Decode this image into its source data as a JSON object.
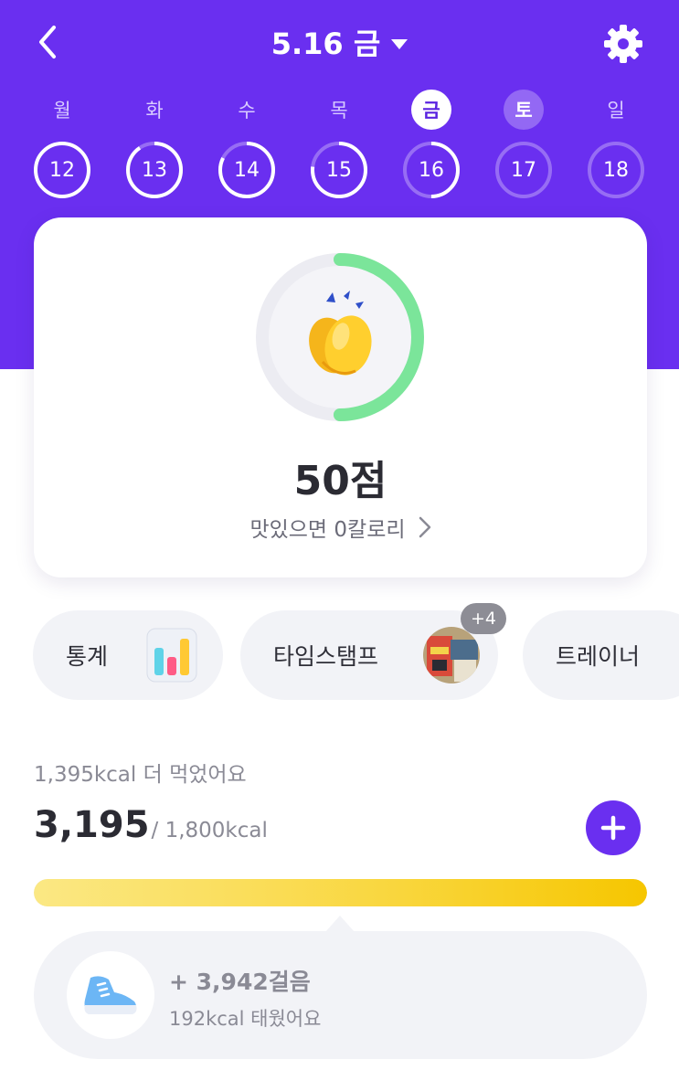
{
  "header": {
    "date_title": "5.16 금",
    "back_icon": "chevron-left-icon",
    "settings_icon": "gear-icon",
    "dropdown_icon": "caret-down-icon"
  },
  "week": {
    "weekdays": [
      "월",
      "화",
      "수",
      "목",
      "금",
      "토",
      "일"
    ],
    "days": [
      "12",
      "13",
      "14",
      "15",
      "16",
      "17",
      "18"
    ],
    "selected_index": 4
  },
  "score_card": {
    "score_text": "50점",
    "score_percent": 50,
    "subtitle": "맛있으면 0칼로리",
    "icon": "clapping-hands-icon",
    "ring_color": "#7be59a"
  },
  "quick_links": {
    "stats_label": "통계",
    "stats_icon": "bar-chart-icon",
    "timestamp_label": "타임스탬프",
    "timestamp_badge": "+4",
    "timestamp_icon": "photo-thumbnail-icon",
    "trainer_label": "트레이너"
  },
  "calories": {
    "surplus_text": "1,395kcal 더 먹었어요",
    "eaten": "3,195",
    "goal": "/ 1,800kcal",
    "progress_fraction": 1.0,
    "add_icon": "plus-icon"
  },
  "steps": {
    "count_text": "+ 3,942걸음",
    "burned_text": "192kcal 태웠어요",
    "icon": "sneaker-icon"
  },
  "colors": {
    "brand": "#6a2ff0",
    "progress": "#f6c600"
  }
}
